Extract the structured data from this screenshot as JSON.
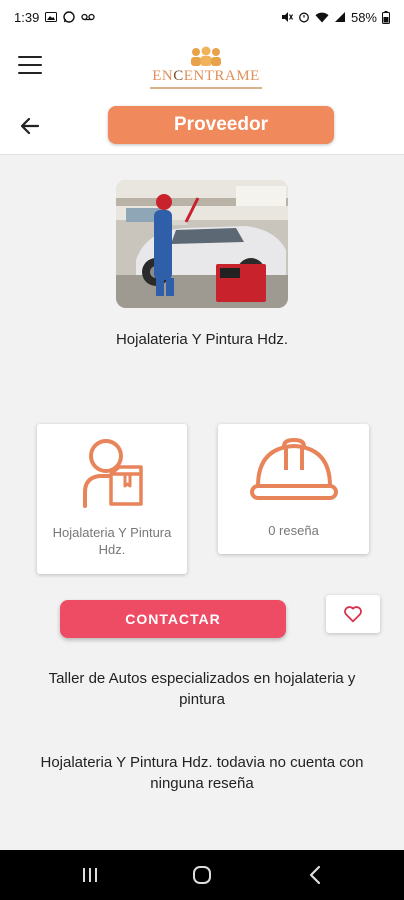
{
  "status_bar": {
    "time": "1:39",
    "battery": "58%",
    "icons": [
      "gallery-icon",
      "whatsapp-icon",
      "voicemail-icon",
      "mute-icon",
      "alarm-icon",
      "wifi-icon",
      "signal-icon",
      "battery-icon"
    ]
  },
  "header": {
    "logo_text_part1": "EN",
    "logo_text_part2": "C",
    "logo_text_part3": "ENTRAME",
    "title": "Proveedor"
  },
  "provider": {
    "name": "Hojalateria Y Pintura Hdz.",
    "card_name": "Hojalateria Y Pintura Hdz.",
    "reviews_count_label": "0 reseña"
  },
  "actions": {
    "contact_label": "CONTACTAR"
  },
  "description": "Taller de Autos especializados en hojalateria y pintura",
  "no_reviews_message": "Hojalateria Y Pintura Hdz. todavia no cuenta con ninguna reseña",
  "colors": {
    "accent_orange": "#f08a5d",
    "contact_red": "#ee4b64",
    "icon_orange": "#e8845a"
  }
}
